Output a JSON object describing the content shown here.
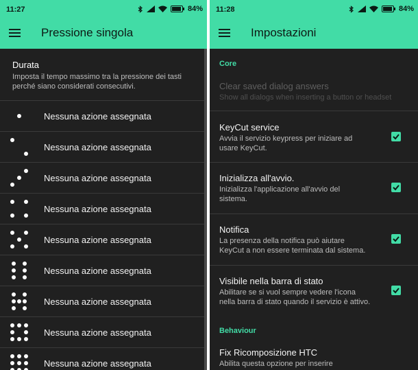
{
  "left": {
    "status": {
      "time": "11:27",
      "battery": "84%"
    },
    "title": "Pressione singola",
    "durata": {
      "title": "Durata",
      "subtitle": "Imposta il tempo massimo tra la pressione dei tasti perché siano considerati consecutivi."
    },
    "items": [
      {
        "dots": 1,
        "label": "Nessuna azione assegnata"
      },
      {
        "dots": 2,
        "label": "Nessuna azione assegnata"
      },
      {
        "dots": 3,
        "label": "Nessuna azione assegnata"
      },
      {
        "dots": 4,
        "label": "Nessuna azione assegnata"
      },
      {
        "dots": 5,
        "label": "Nessuna azione assegnata"
      },
      {
        "dots": 6,
        "label": "Nessuna azione assegnata"
      },
      {
        "dots": 7,
        "label": "Nessuna azione assegnata"
      },
      {
        "dots": 8,
        "label": "Nessuna azione assegnata"
      },
      {
        "dots": 9,
        "label": "Nessuna azione assegnata"
      }
    ]
  },
  "right": {
    "status": {
      "time": "11:28",
      "battery": "84%"
    },
    "title": "Impostazioni",
    "core_label": "Core",
    "clear": {
      "title": "Clear saved dialog answers",
      "subtitle": "Show all dialogs when inserting a button or headset"
    },
    "service": {
      "title": "KeyCut service",
      "subtitle": "Avvia il servizio keypress per iniziare ad usare KeyCut.",
      "checked": true
    },
    "startup": {
      "title": "Inizializza all'avvio.",
      "subtitle": "Inizializza l'applicazione all'avvio del sistema.",
      "checked": true
    },
    "notifica": {
      "title": "Notifica",
      "subtitle": "La presenza della notifica può aiutare KeyCut a non essere terminata dal sistema.",
      "checked": true
    },
    "statusbar": {
      "title": "Visibile nella barra di stato",
      "subtitle": "Abilitare se si vuol sempre vedere l'icona nella barra di stato quando il servizio è attivo.",
      "checked": true
    },
    "behaviour_label": "Behaviour",
    "htc": {
      "title": "Fix Ricomposizione HTC",
      "subtitle": "Abilita questa opzione per inserire"
    }
  },
  "icons": {
    "menu": "hamburger-menu-icon",
    "bluetooth": "bluetooth-icon",
    "signal": "signal-icon",
    "wifi": "wifi-icon",
    "battery": "battery-icon",
    "checkbox": "check-icon"
  },
  "colors": {
    "accent": "#42dca6",
    "background": "#202020",
    "divider": "#3a3a3a"
  }
}
